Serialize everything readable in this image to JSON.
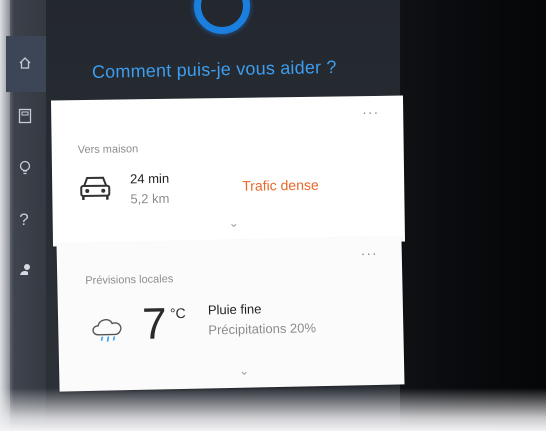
{
  "cortana": {
    "prompt": "Comment puis-je vous aider ?"
  },
  "nav": {
    "items": [
      {
        "icon": "home-icon"
      },
      {
        "icon": "notebook-icon"
      },
      {
        "icon": "lightbulb-icon"
      },
      {
        "icon": "help-icon"
      },
      {
        "icon": "feedback-icon"
      }
    ]
  },
  "commute_card": {
    "title": "Vers maison",
    "duration": "24 min",
    "distance": "5,2 km",
    "traffic": "Trafic dense",
    "more": "···",
    "expand": "⌄"
  },
  "weather_card": {
    "title": "Prévisions locales",
    "temperature": "7",
    "unit": "°C",
    "condition": "Pluie fine",
    "precipitation": "Précipitations 20%",
    "more": "···",
    "expand": "⌄"
  },
  "colors": {
    "accent": "#1a7fde",
    "prompt": "#3d9ef0",
    "traffic": "#e86a2b"
  }
}
